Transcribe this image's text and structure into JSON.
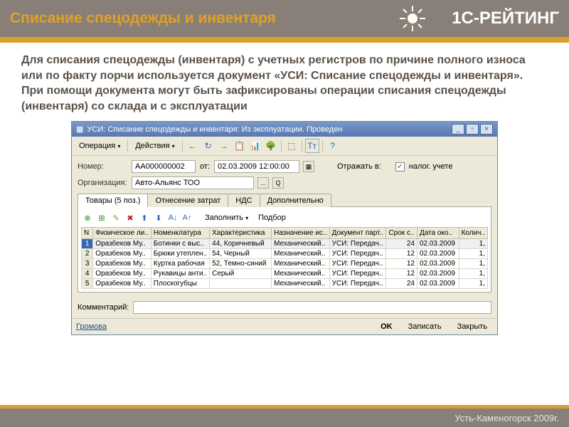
{
  "header": {
    "title": "Списание спецодежды и инвентаря",
    "brand": "1С-РЕЙТИНГ"
  },
  "intro": "Для списания спецодежды (инвентаря) с учетных регистров по причине полного износа или по факту порчи используется документ «УСИ: Списание спецодежды и инвентаря». При помощи документа могут быть зафиксированы операции списания спецодежды (инвентаря) со склада и с эксплуатации",
  "window": {
    "title": "УСИ: Списание спецодежды и инвентаря: Из эксплуатации. Проведен",
    "menu": {
      "op": "Операция",
      "act": "Действия"
    },
    "form": {
      "number_label": "Номер:",
      "number": "АА000000002",
      "from_label": "от:",
      "date": "02.03.2009 12:00:00",
      "reflect_label": "Отражать в:",
      "nalog_label": "налог. учете",
      "org_label": "Организация:",
      "org": "Авто-Альянс ТОО"
    },
    "tabs": {
      "goods": "Товары (5 поз.)",
      "costs": "Отнесение затрат",
      "nds": "НДС",
      "extra": "Дополнительно"
    },
    "table_actions": {
      "fill": "Заполнить",
      "pick": "Подбор"
    },
    "columns": {
      "n": "N",
      "person": "Физическое ли..",
      "nomen": "Номенклатура",
      "char": "Характеристика",
      "purpose": "Назначение ис..",
      "doc": "Документ парт..",
      "term": "Срок с..",
      "end": "Дата око..",
      "qty": "Колич.."
    },
    "rows": [
      {
        "n": "1",
        "person": "Оразбеков Му..",
        "nomen": "Ботинки с выс..",
        "char": "44, Коричневый",
        "purpose": "Механический..",
        "doc": "УСИ: Передач..",
        "term": "24",
        "end": "02.03.2009",
        "qty": "1,"
      },
      {
        "n": "2",
        "person": "Оразбеков Му..",
        "nomen": "Брюки утеплен..",
        "char": "54, Черный",
        "purpose": "Механический..",
        "doc": "УСИ: Передач..",
        "term": "12",
        "end": "02.03.2009",
        "qty": "1,"
      },
      {
        "n": "3",
        "person": "Оразбеков Му..",
        "nomen": "Куртка рабочая",
        "char": "52, Темно-синий",
        "purpose": "Механический..",
        "doc": "УСИ: Передач..",
        "term": "12",
        "end": "02.03.2009",
        "qty": "1,"
      },
      {
        "n": "4",
        "person": "Оразбеков Му..",
        "nomen": "Рукавицы анти..",
        "char": "Серый",
        "purpose": "Механический..",
        "doc": "УСИ: Передач..",
        "term": "12",
        "end": "02.03.2009",
        "qty": "1,"
      },
      {
        "n": "5",
        "person": "Оразбеков Му..",
        "nomen": "Плоскогубцы",
        "char": "",
        "purpose": "Механический..",
        "doc": "УСИ: Передач..",
        "term": "24",
        "end": "02.03.2009",
        "qty": "1,"
      }
    ],
    "comment_label": "Комментарий:",
    "status_user": "Громова",
    "buttons": {
      "ok": "OK",
      "save": "Записать",
      "close": "Закрыть"
    }
  },
  "footer": "Усть-Каменогорск 2009г."
}
